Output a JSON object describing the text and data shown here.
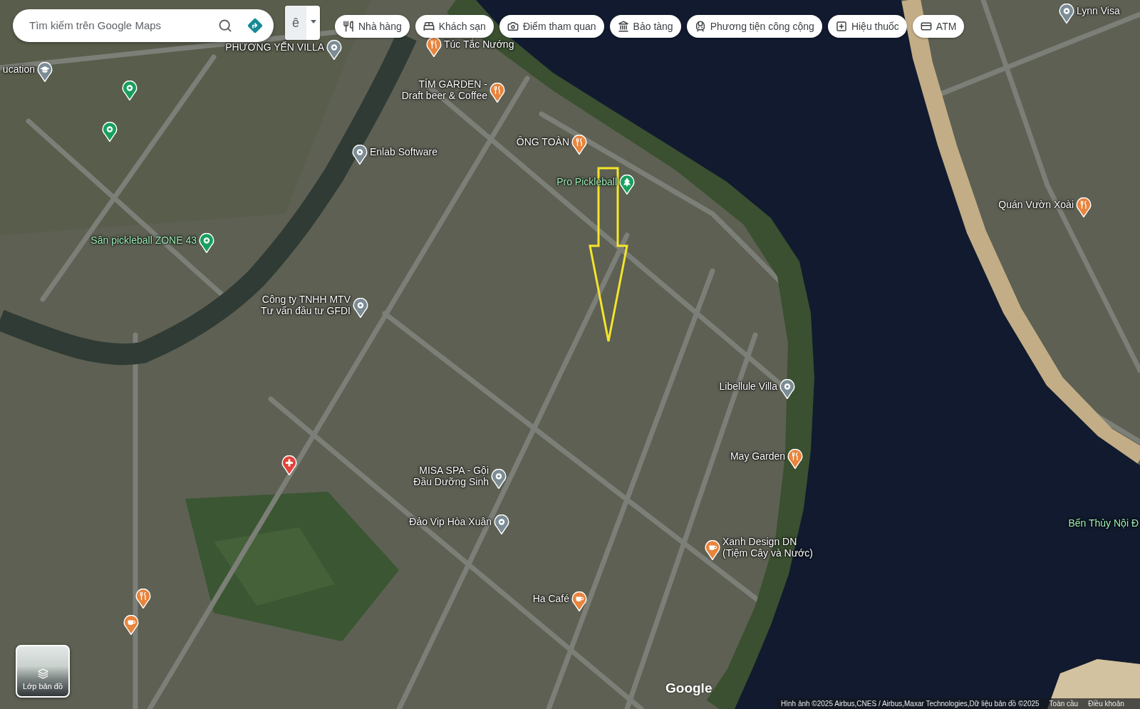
{
  "search": {
    "placeholder": "Tìm kiếm trên Google Maps"
  },
  "input_tool": {
    "label": "ê"
  },
  "category_chips": [
    {
      "kind": "restaurant",
      "label": "Nhà hàng"
    },
    {
      "kind": "hotel",
      "label": "Khách sạn"
    },
    {
      "kind": "attraction",
      "label": "Điểm tham quan"
    },
    {
      "kind": "museum",
      "label": "Bảo tàng"
    },
    {
      "kind": "transit",
      "label": "Phương tiện công cộng"
    },
    {
      "kind": "pharmacy",
      "label": "Hiệu thuốc"
    },
    {
      "kind": "atm",
      "label": "ATM"
    }
  ],
  "map": {
    "annotation": {
      "kind": "arrow"
    },
    "places": [
      {
        "kind": "place",
        "name": "PHƯƠNG YẾN VILLA"
      },
      {
        "kind": "restaurant",
        "name": "Túc Tắc Nướng"
      },
      {
        "kind": "place",
        "name": "Lynn Visa"
      },
      {
        "kind": "education",
        "name": "ucation"
      },
      {
        "kind": "sport"
      },
      {
        "kind": "restaurant",
        "name": "TÍM GARDEN -\nDraft beer & Coffee"
      },
      {
        "kind": "sport"
      },
      {
        "kind": "restaurant",
        "name": "ÔNG TOÀN"
      },
      {
        "kind": "place",
        "name": "Enlab Software"
      },
      {
        "kind": "park",
        "name": "Pro Pickleball"
      },
      {
        "kind": "restaurant",
        "name": "Quán Vườn Xoài"
      },
      {
        "kind": "sport",
        "name": "Sân pickleball ZONE 43"
      },
      {
        "kind": "place",
        "name": "Công ty TNHH MTV\nTư vấn đầu tư GFDI"
      },
      {
        "kind": "place",
        "name": "Libellule Villa"
      },
      {
        "kind": "restaurant",
        "name": "May Garden"
      },
      {
        "kind": "hospital"
      },
      {
        "kind": "place",
        "name": "MISA SPA - Gội\nĐầu Dưỡng Sinh"
      },
      {
        "kind": "place",
        "name": "Đảo Vip Hòa Xuân"
      },
      {
        "kind": "label",
        "name": "Bến Thủy Nội Đ"
      },
      {
        "kind": "cafe",
        "name": "Xanh Design DN\n(Tiệm Cây và Nước)"
      },
      {
        "kind": "cafe",
        "name": "Ha Café"
      },
      {
        "kind": "restaurant"
      },
      {
        "kind": "cafe"
      }
    ]
  },
  "layers_button": {
    "label": "Lớp bản đồ"
  },
  "logo": {
    "text": "Google"
  },
  "attribution": [
    "Hình ảnh ©2025 Airbus,CNES / Airbus,Maxar Technologies,Dữ liệu bản đồ ©2025",
    "Toàn cầu",
    "Điều khoản"
  ]
}
